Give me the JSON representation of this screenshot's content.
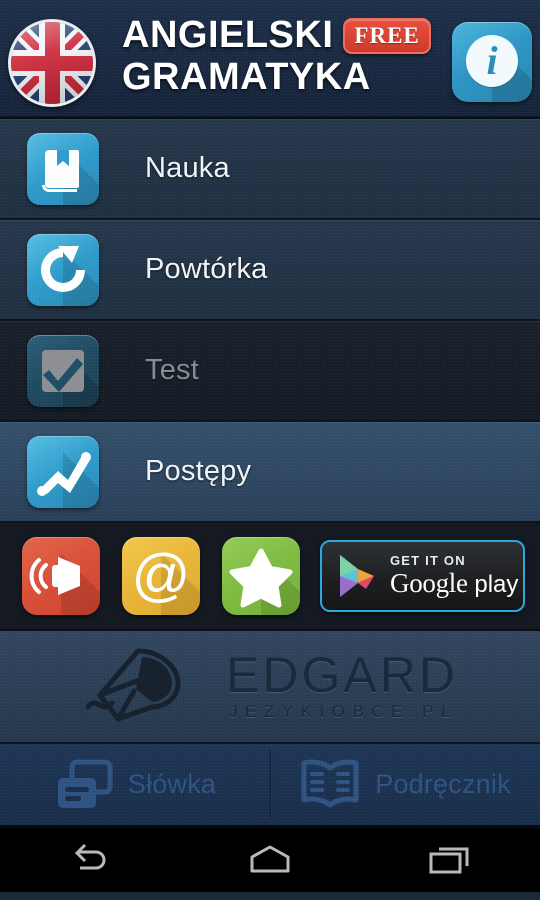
{
  "header": {
    "flag_icon": "uk-flag-icon",
    "title_line1": "ANGIELSKI",
    "title_line2": "GRAMATYKA",
    "free_badge": "FREE",
    "info_button_label": "i",
    "info_icon": "info-icon",
    "accent_color": "#2f9ccb",
    "free_badge_color": "#d9452f"
  },
  "menu": {
    "items": [
      {
        "label": "Nauka",
        "icon": "book-icon",
        "state": "normal"
      },
      {
        "label": "Powtórka",
        "icon": "refresh-icon",
        "state": "normal"
      },
      {
        "label": "Test",
        "icon": "checkbox-icon",
        "state": "disabled"
      },
      {
        "label": "Postępy",
        "icon": "chart-line-icon",
        "state": "active"
      }
    ]
  },
  "actions": {
    "buttons": [
      {
        "name": "sound-button",
        "icon": "speaker-icon",
        "color": "#d9513a"
      },
      {
        "name": "email-button",
        "icon": "at-sign-icon",
        "color": "#e8b63b"
      },
      {
        "name": "rate-button",
        "icon": "star-icon",
        "color": "#7fbc42"
      }
    ],
    "google_play": {
      "get_it_on": "GET IT ON",
      "store_name": "Google",
      "store_name_2": "play",
      "border_color": "#2aa8e0"
    }
  },
  "brand": {
    "name": "EDGARD",
    "subtitle": "JEZYKIOBCE.PL",
    "logo_icon": "edgard-mouse-icon"
  },
  "tabs": [
    {
      "label": "Słówka",
      "icon": "cards-icon"
    },
    {
      "label": "Podręcznik",
      "icon": "open-book-icon"
    }
  ],
  "navbar": {
    "back": "back-icon",
    "home": "home-icon",
    "recents": "recents-icon"
  }
}
